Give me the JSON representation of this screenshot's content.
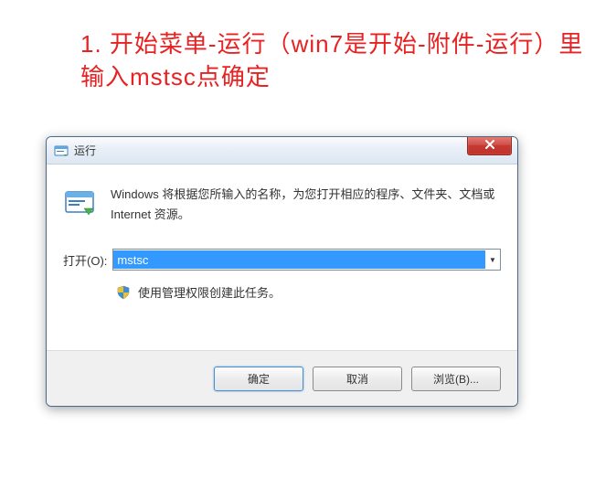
{
  "instruction": "1. 开始菜单-运行（win7是开始-附件-运行）里输入mstsc点确定",
  "dialog": {
    "title": "运行",
    "info": "Windows 将根据您所输入的名称，为您打开相应的程序、文件夹、文档或 Internet 资源。",
    "open_label": "打开(O):",
    "input_value": "mstsc",
    "shield_text": "使用管理权限创建此任务。",
    "buttons": {
      "ok": "确定",
      "cancel": "取消",
      "browse": "浏览(B)..."
    }
  }
}
